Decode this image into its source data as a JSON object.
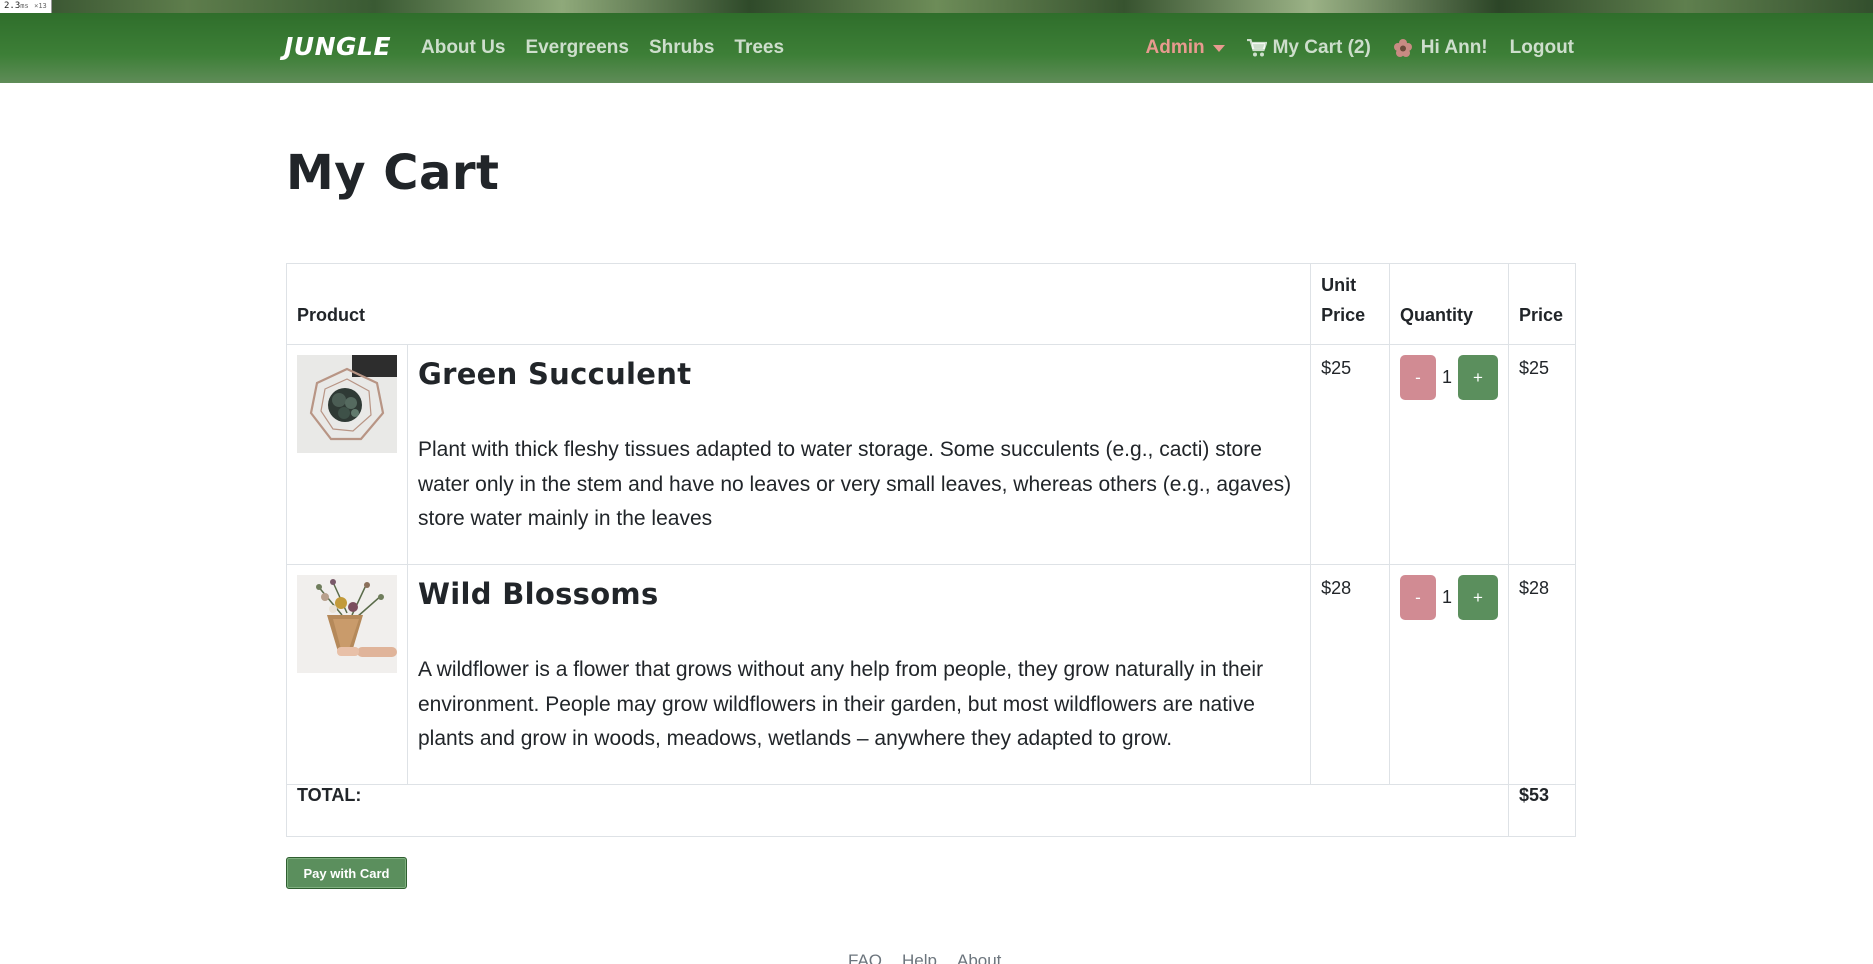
{
  "perf": {
    "value": "2.3",
    "unit": "ms",
    "count": "×13"
  },
  "nav": {
    "brand": "JUNGLE",
    "links": [
      "About Us",
      "Evergreens",
      "Shrubs",
      "Trees"
    ],
    "admin": "Admin",
    "cart": "My Cart (2)",
    "greeting": "Hi Ann!",
    "logout": "Logout"
  },
  "page": {
    "title": "My Cart"
  },
  "table": {
    "headers": {
      "product": "Product",
      "unit_price": "Unit Price",
      "quantity": "Quantity",
      "price": "Price"
    },
    "items": [
      {
        "name": "Green Succulent",
        "description": "Plant with thick fleshy tissues adapted to water storage. Some succulents (e.g., cacti) store water only in the stem and have no leaves or very small leaves, whereas others (e.g., agaves) store water mainly in the leaves",
        "unit_price": "$25",
        "quantity": "1",
        "price": "$25",
        "image_icon": "succulent-image"
      },
      {
        "name": "Wild Blossoms",
        "description": "A wildflower is a flower that grows without any help from people, they grow naturally in their environment. People may grow wildflowers in their garden, but most wildflowers are native plants and grow in woods, meadows, wetlands – anywhere they adapted to grow.",
        "unit_price": "$28",
        "quantity": "1",
        "price": "$28",
        "image_icon": "bouquet-image"
      }
    ],
    "minus_label": "-",
    "plus_label": "+",
    "total_label": "TOTAL:",
    "total_value": "$53"
  },
  "pay_button": "Pay with Card",
  "footer": {
    "links": [
      "FAQ",
      "Help",
      "About"
    ]
  },
  "colors": {
    "nav_green": "#3d7f37",
    "admin_pink": "#e89a8f",
    "minus_button": "#d18b93",
    "plus_button": "#5b8f5d"
  }
}
